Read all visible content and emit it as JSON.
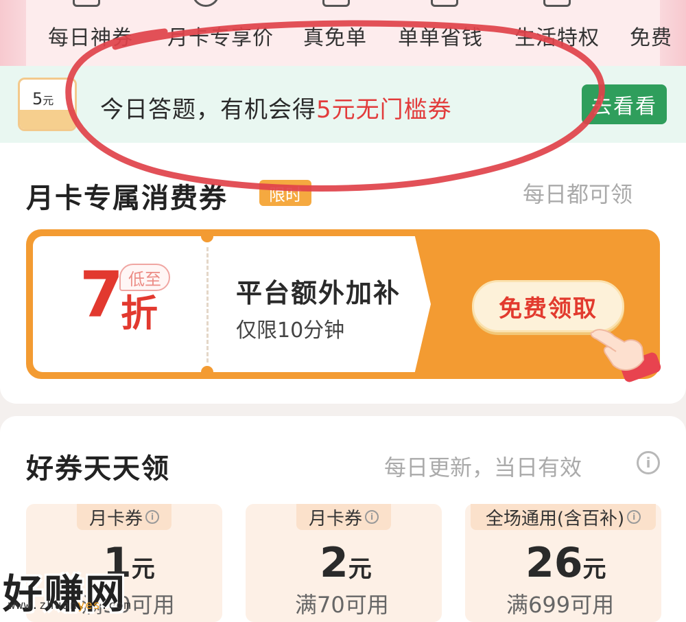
{
  "categories": [
    "每日神券",
    "月卡专享价",
    "真免单",
    "单单省钱",
    "生活特权",
    "免费"
  ],
  "quiz_banner": {
    "coupon_value": "5",
    "coupon_unit": "元",
    "text_prefix": "今日答题，有机会得",
    "text_highlight": "5元无门槛券",
    "button_label": "去看看"
  },
  "month_card": {
    "title": "月卡专属消费券",
    "badge": "限时",
    "subtitle": "每日都可领",
    "promo": {
      "discount": "7",
      "discount_unit": "折",
      "tag": "低至",
      "headline": "平台额外加补",
      "note": "仅限10分钟",
      "button_label": "免费领取"
    }
  },
  "daily": {
    "title": "好券天天领",
    "subtitle": "每日更新，当日有效",
    "coupons": [
      {
        "tag": "月卡券",
        "amount": "1",
        "unit": "元",
        "condition": "满50可用"
      },
      {
        "tag": "月卡券",
        "amount": "2",
        "unit": "元",
        "condition": "满70可用"
      },
      {
        "tag": "全场通用(含百补)",
        "amount": "26",
        "unit": "元",
        "condition": "满699可用"
      }
    ]
  },
  "watermark": {
    "text": "好赚网",
    "url_prefix": "www.zhuan",
    "url_mid": "yes",
    "url_suffix": ".com"
  },
  "colors": {
    "accent_red": "#e2392f",
    "orange": "#f39b32",
    "green_button": "#2f9e5c",
    "annotation": "#e0424a"
  }
}
